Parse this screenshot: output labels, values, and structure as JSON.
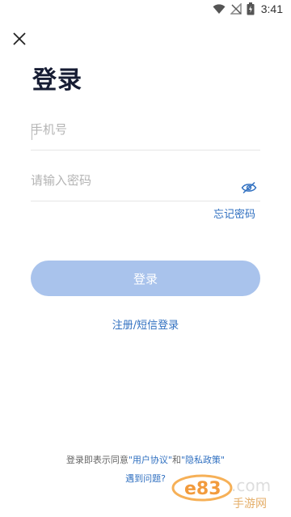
{
  "status_bar": {
    "time": "3:41",
    "icons": [
      "wifi-icon",
      "no-signal-icon",
      "battery-icon"
    ]
  },
  "header": {
    "close_icon": "close-icon",
    "title": "登录"
  },
  "form": {
    "phone_placeholder": "手机号",
    "password_placeholder": "请输入密码",
    "toggle_icon": "eye-hidden-icon",
    "forgot_label": "忘记密码",
    "login_label": "登录",
    "sms_label": "注册/短信登录"
  },
  "footer": {
    "agreement_prefix": "登录即表示同意",
    "user_agreement": "\"用户协议\"",
    "and_text": "和",
    "privacy_policy": "\"隐私政策\"",
    "help_label": "遇到问题?"
  },
  "colors": {
    "accent": "#2f6fc0",
    "button_disabled": "#a9c3ec",
    "title": "#161c33"
  },
  "watermark": {
    "brand": "e83",
    "domain": ".com",
    "text": "手游网"
  }
}
